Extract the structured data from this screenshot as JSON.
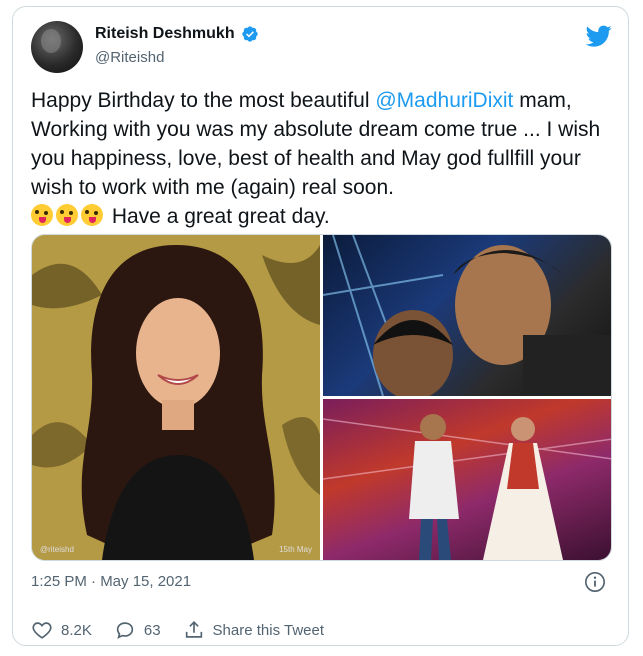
{
  "author": {
    "display_name": "Riteish Deshmukh",
    "handle": "@Riteishd",
    "verified": true
  },
  "tweet": {
    "text_before_mention": "Happy Birthday to the most beautiful ",
    "mention": "@MadhuriDixit",
    "text_after_mention": " mam, Working with you was my absolute dream come true ... I wish you happiness, love, best of health and May god fullfill your wish to work with me (again) real soon.",
    "emoji_line_text": " Have a great great day.",
    "emoji_count": 3,
    "emoji_icon": "zany-face-emoji"
  },
  "media": {
    "images": [
      {
        "name": "birthday-illustration",
        "watermark": "@riteishd",
        "date_label": "15th May"
      },
      {
        "name": "selfie-photo"
      },
      {
        "name": "stage-dance-photo"
      }
    ]
  },
  "meta": {
    "timestamp": "1:25 PM · May 15, 2021"
  },
  "actions": {
    "likes": "8.2K",
    "replies": "63",
    "share_label": "Share this Tweet"
  },
  "colors": {
    "accent": "#1d9bf0",
    "secondary_text": "#536471",
    "border": "#cfd9de"
  }
}
